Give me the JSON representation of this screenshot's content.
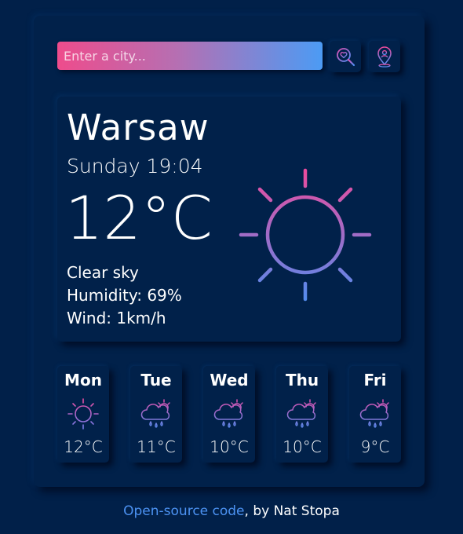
{
  "search": {
    "placeholder": "Enter a city...",
    "search_icon": "search-heart-icon",
    "location_icon": "location-pin-icon"
  },
  "current": {
    "city": "Warsaw",
    "datetime": "Sunday 19:04",
    "temperature": "12°C",
    "description": "Clear sky",
    "humidity": "Humidity: 69%",
    "wind": "Wind: 1km/h",
    "icon": "sun-icon"
  },
  "forecast": [
    {
      "day": "Mon",
      "temp": "12°C",
      "icon": "sun-icon"
    },
    {
      "day": "Tue",
      "temp": "11°C",
      "icon": "rain-cloud-icon"
    },
    {
      "day": "Wed",
      "temp": "10°C",
      "icon": "rain-cloud-icon"
    },
    {
      "day": "Thu",
      "temp": "10°C",
      "icon": "rain-cloud-icon"
    },
    {
      "day": "Fri",
      "temp": "9°C",
      "icon": "rain-cloud-icon"
    }
  ],
  "footer": {
    "link_text": "Open-source code",
    "suffix": ", by Nat Stopa"
  },
  "colors": {
    "background": "#012049",
    "gradient_pink": "#ee4c8c",
    "gradient_blue": "#4c9bf4",
    "link": "#4c92f2"
  }
}
